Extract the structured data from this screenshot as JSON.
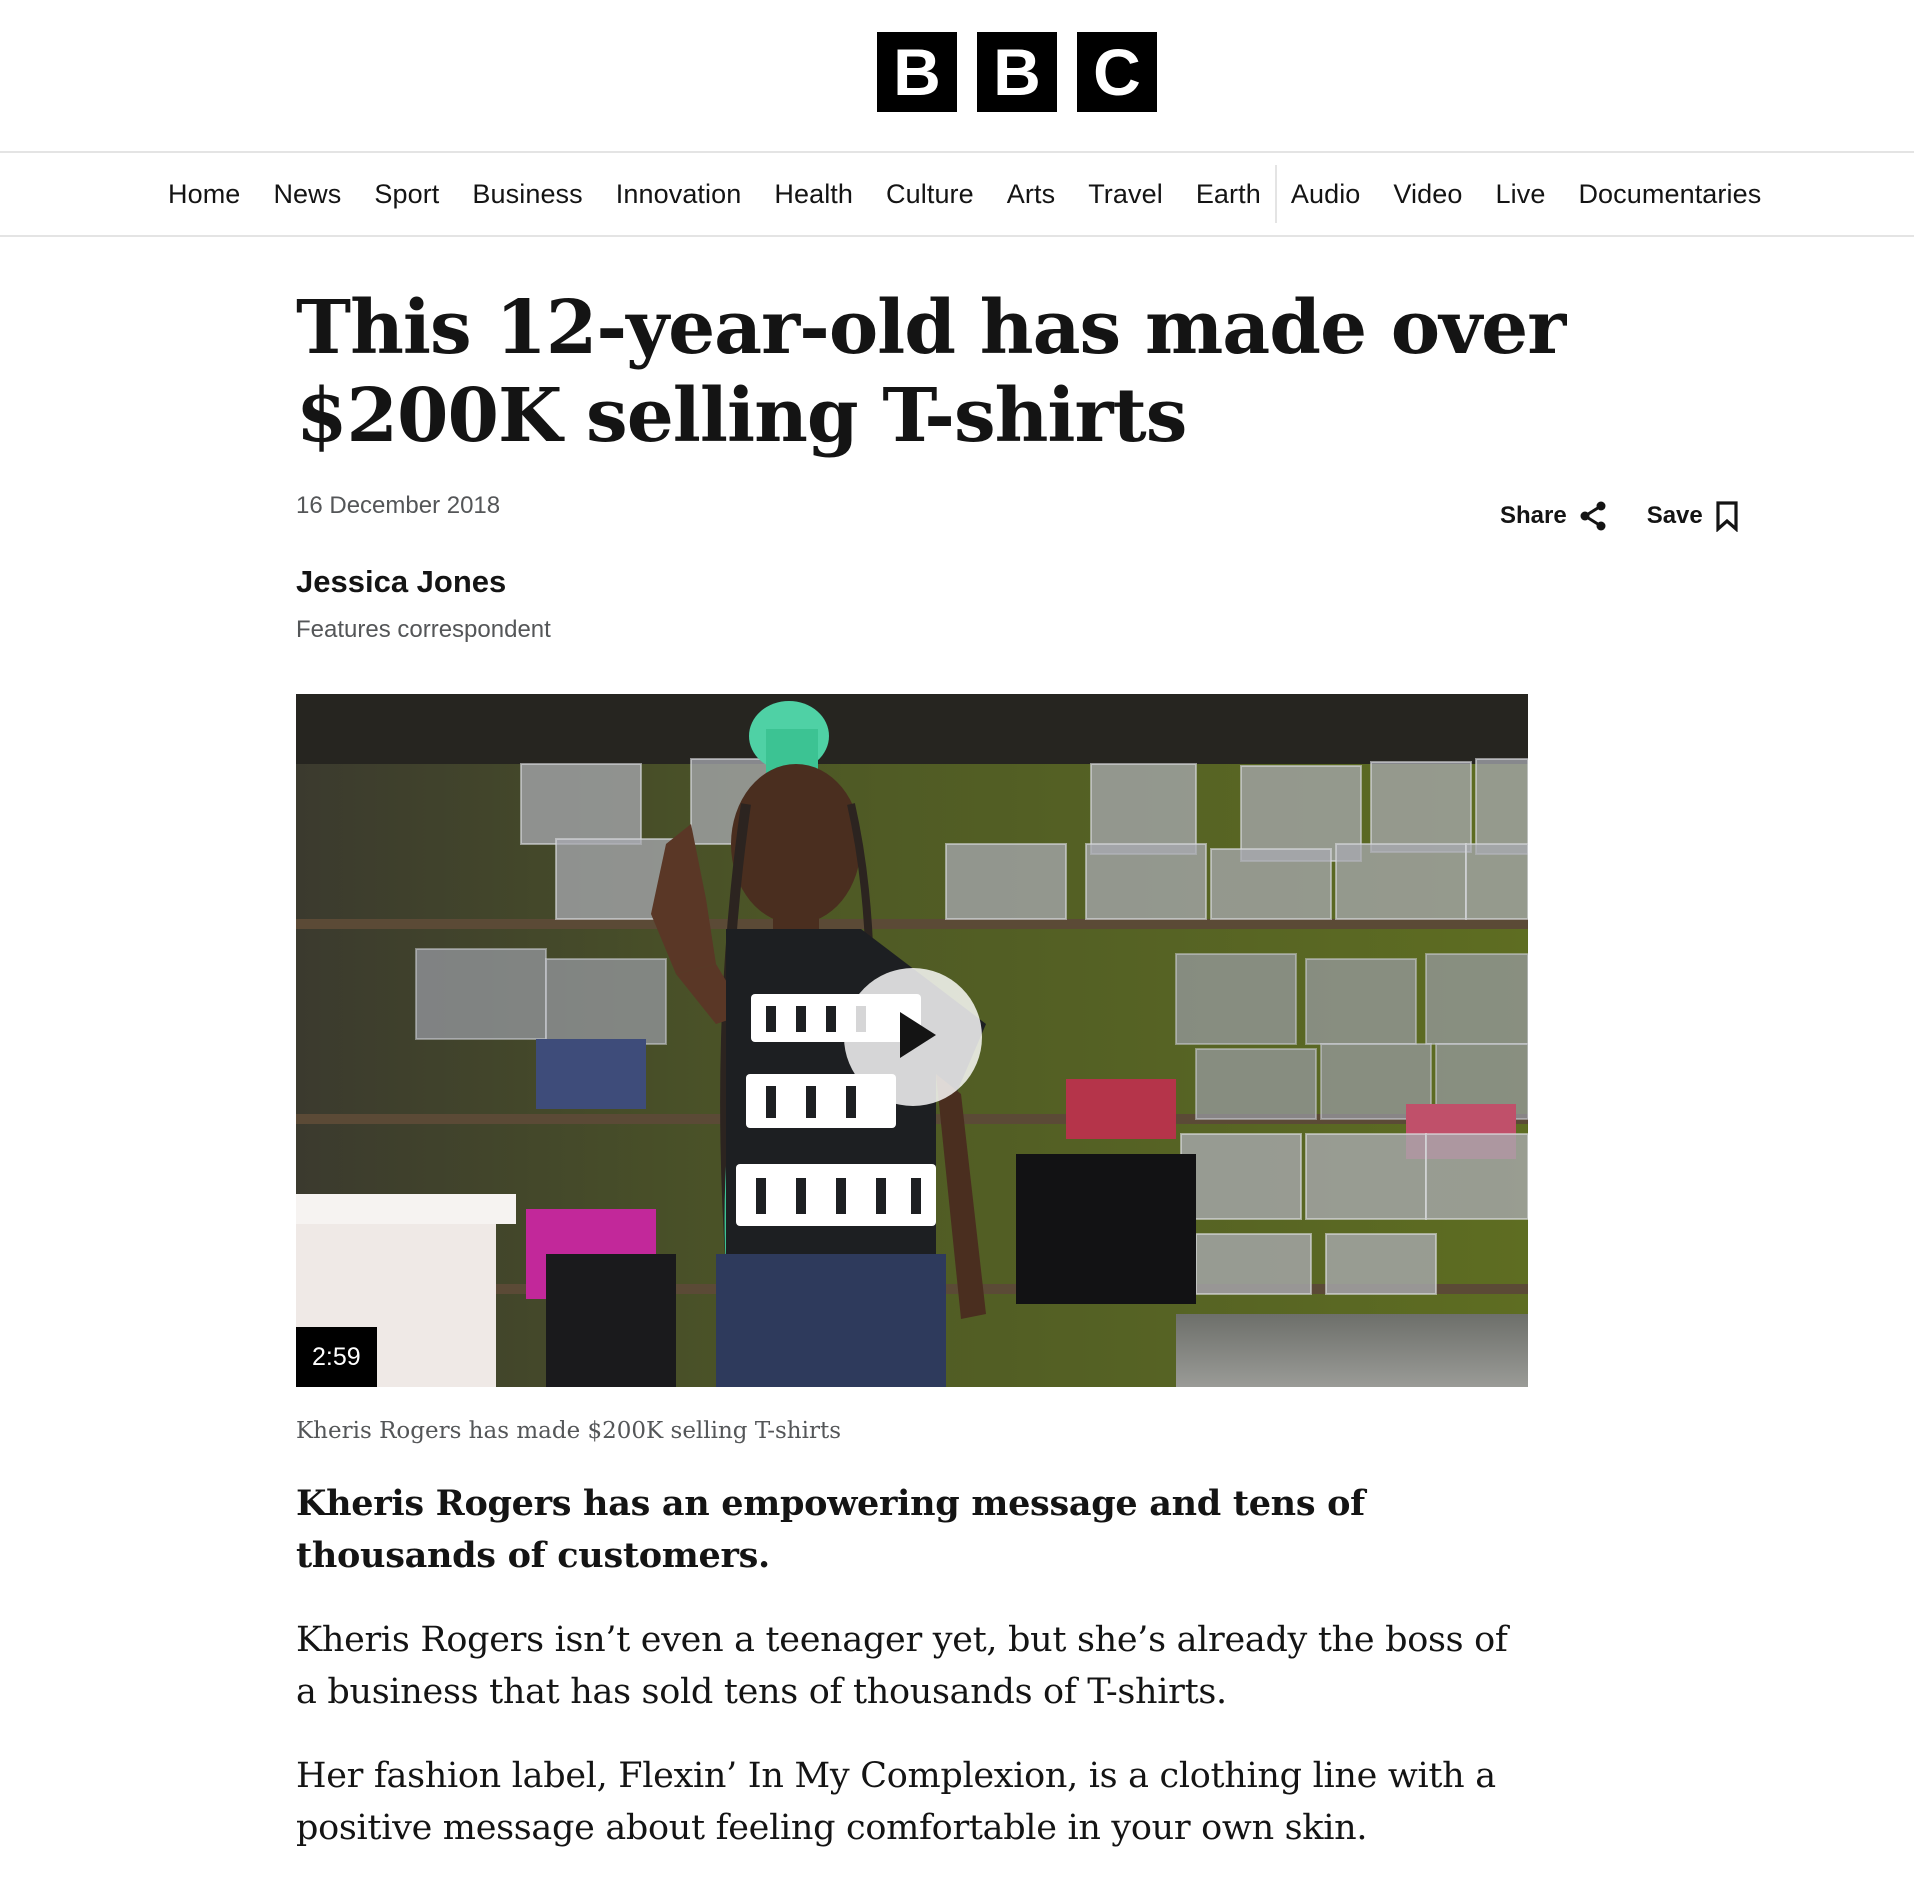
{
  "logo": {
    "letters": [
      "B",
      "B",
      "C"
    ]
  },
  "nav": {
    "items_primary": [
      "Home",
      "News",
      "Sport",
      "Business",
      "Innovation",
      "Health",
      "Culture",
      "Arts",
      "Travel",
      "Earth"
    ],
    "items_secondary": [
      "Audio",
      "Video",
      "Live",
      "Documentaries"
    ]
  },
  "article": {
    "headline": "This 12-year-old has made over $200K selling T-shirts",
    "date": "16 December 2018",
    "share_label": "Share",
    "save_label": "Save",
    "author_name": "Jessica Jones",
    "author_role": "Features correspondent",
    "video": {
      "duration": "2:59",
      "caption": "Kheris Rogers has made $200K selling T-shirts"
    },
    "lead": "Kheris Rogers has an empowering message and tens of thousands of customers.",
    "paragraphs": [
      "Kheris Rogers isn’t even a teenager yet, but she’s already the boss of a business that has sold tens of thousands of T-shirts.",
      "Her fashion label, Flexin’ In My Complexion, is a clothing line with a positive message about feeling comfortable in your own skin."
    ]
  },
  "colors": {
    "text": "#141414",
    "muted": "#545658",
    "divider": "#e4e4e4",
    "logo_bg": "#000000"
  }
}
